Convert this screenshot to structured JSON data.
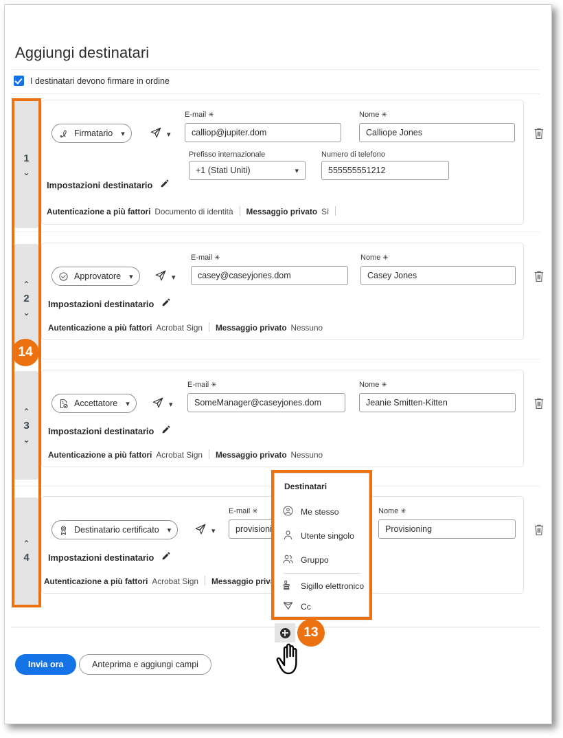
{
  "window": {
    "title": "Aggiungi destinatari"
  },
  "header": {
    "title": "Aggiungi destinatari",
    "order_checkbox_label": "I destinatari devono firmare in ordine",
    "order_checkbox_checked": true
  },
  "annotations": [
    {
      "label": "14",
      "target": "order-rail"
    },
    {
      "label": "13",
      "target": "add-recipient-button"
    }
  ],
  "labels": {
    "email": "E-mail",
    "name": "Nome",
    "country_code": "Prefisso internazionale",
    "phone": "Numero di telefono",
    "required_mark": "✳",
    "recipient_settings": "Impostazioni destinatario",
    "mfa": "Autenticazione a più fattori",
    "private_message": "Messaggio privato"
  },
  "recipients": [
    {
      "order": "1",
      "has_up": false,
      "has_down": true,
      "role": "Firmatario",
      "role_icon": "signature-pen-icon",
      "email": "calliop@jupiter.dom",
      "name": "Calliope Jones",
      "country_code": "+1 (Stati Uniti)",
      "phone": "555555551212",
      "show_phone": true,
      "mfa_value": "Documento di identità",
      "private_message_value": "Sì"
    },
    {
      "order": "2",
      "has_up": true,
      "has_down": true,
      "role": "Approvatore",
      "role_icon": "check-circle-icon",
      "email": "casey@caseyjones.dom",
      "name": "Casey Jones",
      "show_phone": false,
      "mfa_value": "Acrobat Sign",
      "private_message_value": "Nessuno"
    },
    {
      "order": "3",
      "has_up": true,
      "has_down": true,
      "role": "Accettatore",
      "role_icon": "document-check-icon",
      "email": "SomeManager@caseyjones.dom",
      "name": "Jeanie Smitten-Kitten",
      "show_phone": false,
      "mfa_value": "Acrobat Sign",
      "private_message_value": "Nessuno"
    },
    {
      "order": "4",
      "has_up": true,
      "has_down": false,
      "role": "Destinatario certificato",
      "role_icon": "certificate-ribbon-icon",
      "email": "provisioni",
      "name": "Provisioning",
      "show_phone": false,
      "mfa_value": "Acrobat Sign",
      "private_message_value": ""
    }
  ],
  "recipient_type_menu": {
    "title": "Destinatari",
    "items": [
      {
        "label": "Me stesso",
        "icon": "person-circle-icon"
      },
      {
        "label": "Utente singolo",
        "icon": "person-icon"
      },
      {
        "label": "Gruppo",
        "icon": "people-group-icon"
      },
      {
        "label": "Sigillo elettronico",
        "icon": "stamp-icon"
      },
      {
        "label": "Cc",
        "icon": "paper-plane-outline-icon"
      }
    ],
    "divider_after_index": 2
  },
  "footer": {
    "send_now": "Invia ora",
    "preview_and_add_fields": "Anteprima e aggiungi campi"
  },
  "colors": {
    "accent_orange": "#ec7211",
    "primary_blue": "#1473e6",
    "rail_grey": "#e3e3e3",
    "card_border": "#e2e2e2"
  }
}
